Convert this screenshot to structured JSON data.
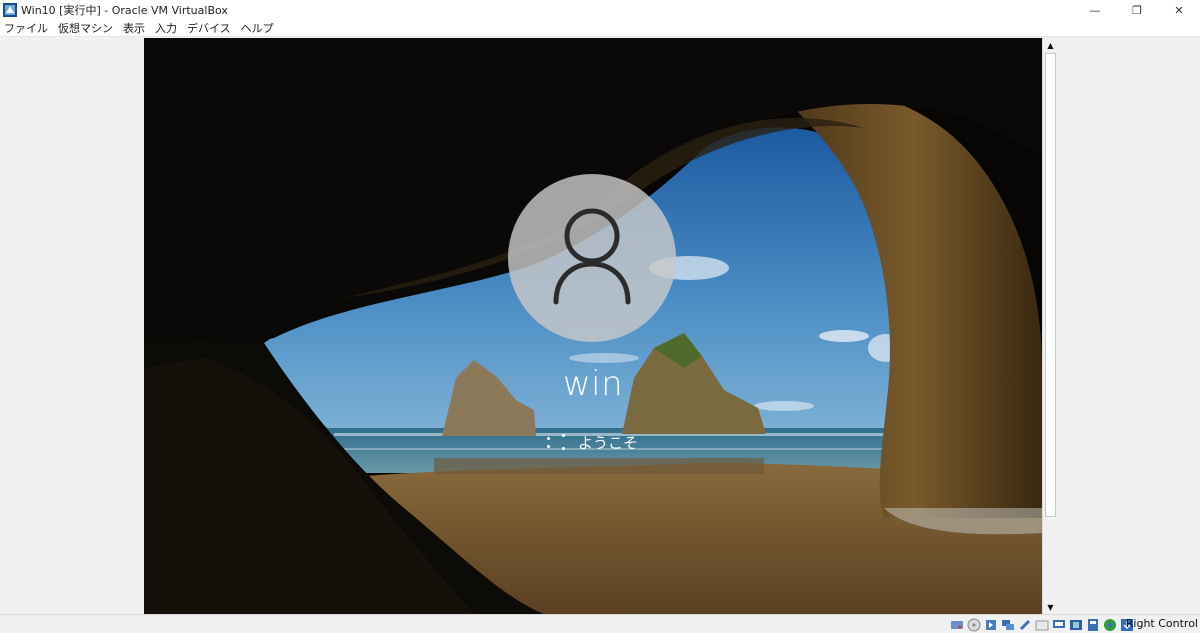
{
  "window": {
    "title": "Win10 [実行中] - Oracle VM VirtualBox",
    "controls": {
      "minimize": "—",
      "restore": "❐",
      "close": "✕"
    }
  },
  "menu": {
    "items": [
      "ファイル",
      "仮想マシン",
      "表示",
      "入力",
      "デバイス",
      "ヘルプ"
    ]
  },
  "login": {
    "username": "win",
    "status": "ようこそ"
  },
  "scrollbar": {
    "up_arrow": "▲",
    "down_arrow": "▼"
  },
  "statusbar": {
    "icons": [
      "hard-disk-icon",
      "optical-drive-icon",
      "audio-icon",
      "network-icon",
      "usb-icon",
      "shared-folders-icon",
      "display-icon",
      "video-capture-icon",
      "cpu-icon",
      "mouse-integration-icon",
      "keyboard-capture-icon"
    ],
    "host_key": "Right Control"
  }
}
